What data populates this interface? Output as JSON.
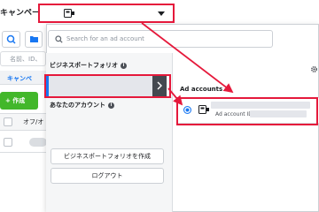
{
  "page": {
    "title": "キャンペーン",
    "filter_placeholder": "名前、ID、",
    "tab_label": "キャンペ",
    "create_button": "+ 作成",
    "column_onoff": "オフ/オ"
  },
  "dropdown": {
    "search_placeholder": "Search for an ad account",
    "business_portfolio_title": "ビジネスポートフォリオ",
    "your_accounts_title": "あなたのアカウント",
    "ad_accounts_title": "Ad accounts",
    "account_id_label": "Ad account ID:",
    "create_portfolio_button": "ビジネスポートフォリオを作成",
    "logout_button": "ログアウト"
  },
  "icons": {
    "search": "search-icon",
    "folder": "folder-icon",
    "ad_account": "ad-account-icon",
    "gear": "gear-icon",
    "info": "info-icon",
    "chevron": "chevron-right-icon",
    "caret": "caret-down-icon"
  },
  "colors": {
    "accent": "#1877f2",
    "create_green": "#42b72a",
    "highlight_red": "#e5193b",
    "expand_dark": "#444950"
  }
}
